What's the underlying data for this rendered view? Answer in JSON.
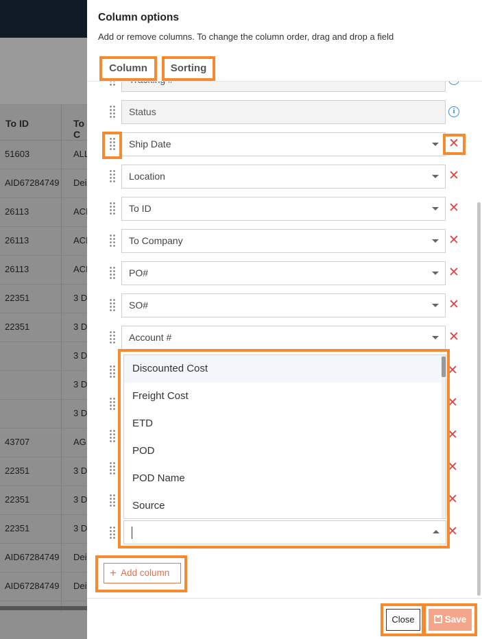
{
  "background": {
    "headers": [
      "To ID",
      "To C"
    ],
    "rows": [
      [
        "51603",
        "ALL"
      ],
      [
        "AID67284749",
        "Dei"
      ],
      [
        "26113",
        "ACI"
      ],
      [
        "26113",
        "ACI"
      ],
      [
        "26113",
        "ACI"
      ],
      [
        "22351",
        "3 D"
      ],
      [
        "22351",
        "3 D"
      ],
      [
        "",
        "3 D"
      ],
      [
        "",
        "3 D"
      ],
      [
        "",
        "3 D"
      ],
      [
        "43707",
        "AG"
      ],
      [
        "22351",
        "3 D"
      ],
      [
        "22351",
        "3 D"
      ],
      [
        "22351",
        "3 D"
      ],
      [
        "AID67284749",
        "Dei"
      ],
      [
        "AID67284749",
        "Dei"
      ]
    ]
  },
  "panel": {
    "title": "Column options",
    "subtitle": "Add or remove columns. To change the column order, drag and drop a field",
    "tabs": {
      "column": "Column",
      "sorting": "Sorting"
    },
    "fields": [
      {
        "label": "Tracking #",
        "locked": true
      },
      {
        "label": "Status",
        "locked": true
      },
      {
        "label": "Ship Date",
        "locked": false
      },
      {
        "label": "Location",
        "locked": false
      },
      {
        "label": "To ID",
        "locked": false
      },
      {
        "label": "To Company",
        "locked": false
      },
      {
        "label": "PO#",
        "locked": false
      },
      {
        "label": "SO#",
        "locked": false
      },
      {
        "label": "Account #",
        "locked": false
      }
    ],
    "dropdown": {
      "options": [
        "Discounted Cost",
        "Freight Cost",
        "ETD",
        "POD",
        "POD Name",
        "Source"
      ],
      "input_value": ""
    },
    "info_icon": "i",
    "remove_icon": "✕",
    "add_column_label": "Add column",
    "add_icon": "+",
    "close_label": "Close",
    "save_label": "Save"
  },
  "colors": {
    "highlight": "#f7892e",
    "remove": "#e04545",
    "info": "#3a8ad8",
    "save_bg": "#f4a58a"
  }
}
